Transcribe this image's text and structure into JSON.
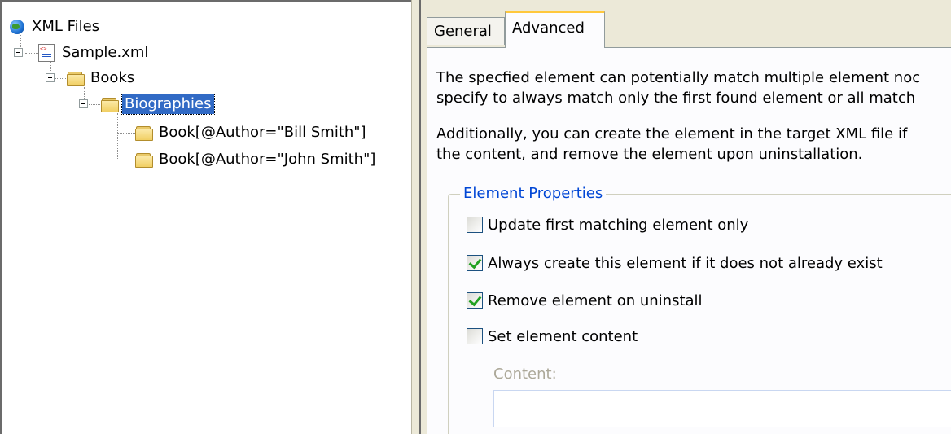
{
  "tree": {
    "root": {
      "label": "XML Files",
      "icon": "globe-icon"
    },
    "file": {
      "label": "Sample.xml",
      "icon": "xml-file-icon"
    },
    "books": {
      "label": "Books",
      "icon": "folder-icon"
    },
    "biographies": {
      "label": "Biographies",
      "icon": "folder-icon",
      "selected": true
    },
    "book1": {
      "label": "Book[@Author=\"Bill Smith\"]",
      "icon": "folder-icon"
    },
    "book2": {
      "label": "Book[@Author=\"John Smith\"]",
      "icon": "folder-icon"
    }
  },
  "tabs": {
    "general": "General",
    "advanced": "Advanced",
    "active": "Advanced"
  },
  "advanced": {
    "para1_line1": "The specfied element can potentially match multiple element noc",
    "para1_line2": "specify to always match only the first found element or all match",
    "para2_line1": "Additionally, you can create the element in the target XML file if",
    "para2_line2": "the content, and remove the element upon uninstallation.",
    "group_title": "Element Properties",
    "options": [
      {
        "label": "Update first matching element only",
        "checked": false
      },
      {
        "label": "Always create this element if it does not already exist",
        "checked": true
      },
      {
        "label": "Remove element on uninstall",
        "checked": true
      },
      {
        "label": "Set element content",
        "checked": false
      }
    ],
    "content_label": "Content:",
    "content_value": ""
  },
  "colors": {
    "selection": "#316ac5",
    "group_title": "#0046d5",
    "active_tab_accent": "#ffc83c",
    "check_mark": "#21a121",
    "disabled_text": "#aca899"
  }
}
